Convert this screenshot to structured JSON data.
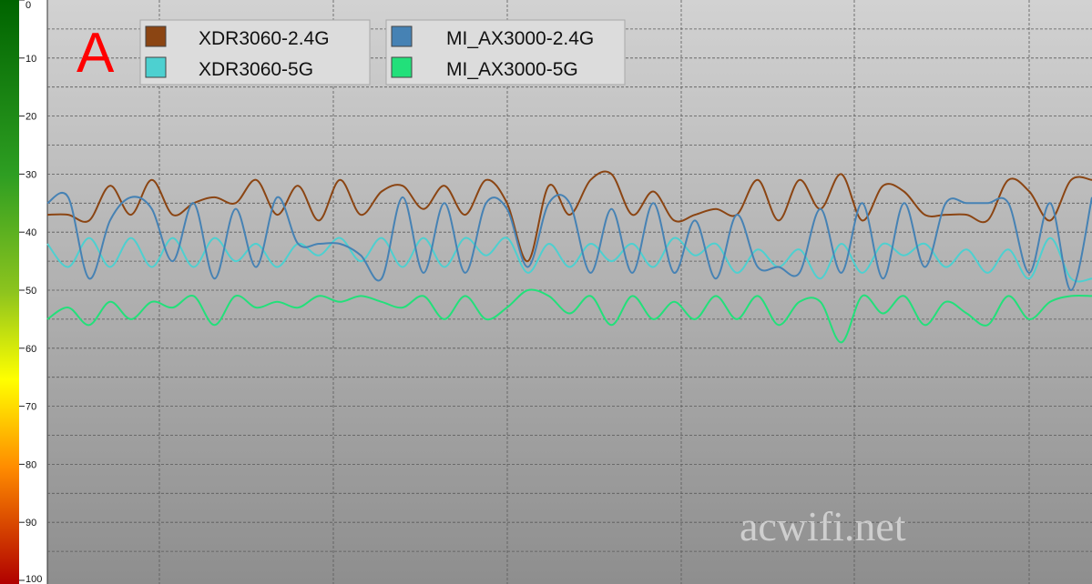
{
  "panel_label": "A",
  "watermark": "acwifi.net",
  "colors": {
    "XDR3060-2.4G": "#8b4513",
    "XDR3060-5G": "#4dd0d0",
    "MI_AX3000-2.4G": "#4682b4",
    "MI_AX3000-5G": "#22e07a"
  },
  "chart_data": {
    "type": "line",
    "title": "",
    "xlabel": "",
    "ylabel": "",
    "ylim": [
      0,
      100
    ],
    "y_inverted": true,
    "y_ticks": [
      0,
      10,
      20,
      30,
      40,
      50,
      60,
      70,
      80,
      90,
      100
    ],
    "y_tick_labels": [
      "0",
      "10",
      "20",
      "30",
      "40",
      "50",
      "60",
      "70",
      "80",
      "90",
      "100"
    ],
    "xlim": [
      0,
      50
    ],
    "grid": true,
    "legend_position": "top-left",
    "series": [
      {
        "name": "XDR3060-2.4G",
        "values": [
          37,
          37,
          38,
          32,
          37,
          31,
          37,
          35,
          34,
          35,
          31,
          37,
          32,
          38,
          31,
          37,
          33,
          32,
          36,
          32,
          37,
          31,
          35,
          45,
          32,
          37,
          31,
          30,
          37,
          33,
          38,
          37,
          36,
          37,
          31,
          38,
          31,
          36,
          30,
          38,
          32,
          33,
          37,
          37,
          37,
          38,
          31,
          33,
          38,
          31,
          31
        ]
      },
      {
        "name": "XDR3060-5G",
        "values": [
          42,
          46,
          41,
          46,
          41,
          46,
          41,
          46,
          41,
          45,
          42,
          46,
          42,
          44,
          41,
          45,
          41,
          46,
          41,
          46,
          41,
          44,
          41,
          47,
          42,
          46,
          42,
          45,
          42,
          46,
          41,
          44,
          42,
          47,
          43,
          46,
          43,
          48,
          42,
          47,
          42,
          44,
          42,
          46,
          43,
          47,
          43,
          48,
          41,
          48,
          48
        ]
      },
      {
        "name": "MI_AX3000-2.4G",
        "values": [
          35,
          34,
          48,
          38,
          34,
          36,
          45,
          35,
          48,
          36,
          46,
          34,
          42,
          42,
          42,
          44,
          48,
          34,
          47,
          35,
          47,
          35,
          36,
          46,
          35,
          35,
          47,
          36,
          47,
          35,
          47,
          38,
          48,
          37,
          46,
          46,
          47,
          36,
          47,
          35,
          48,
          35,
          46,
          35,
          35,
          35,
          35,
          47,
          35,
          50,
          34
        ]
      },
      {
        "name": "MI_AX3000-5G",
        "values": [
          55,
          53,
          56,
          52,
          55,
          52,
          53,
          51,
          56,
          51,
          53,
          52,
          53,
          51,
          52,
          51,
          52,
          53,
          51,
          55,
          51,
          55,
          53,
          50,
          51,
          54,
          51,
          56,
          51,
          55,
          52,
          55,
          51,
          55,
          51,
          56,
          52,
          52,
          59,
          51,
          54,
          51,
          56,
          52,
          54,
          56,
          51,
          55,
          52,
          51,
          51
        ]
      }
    ]
  }
}
